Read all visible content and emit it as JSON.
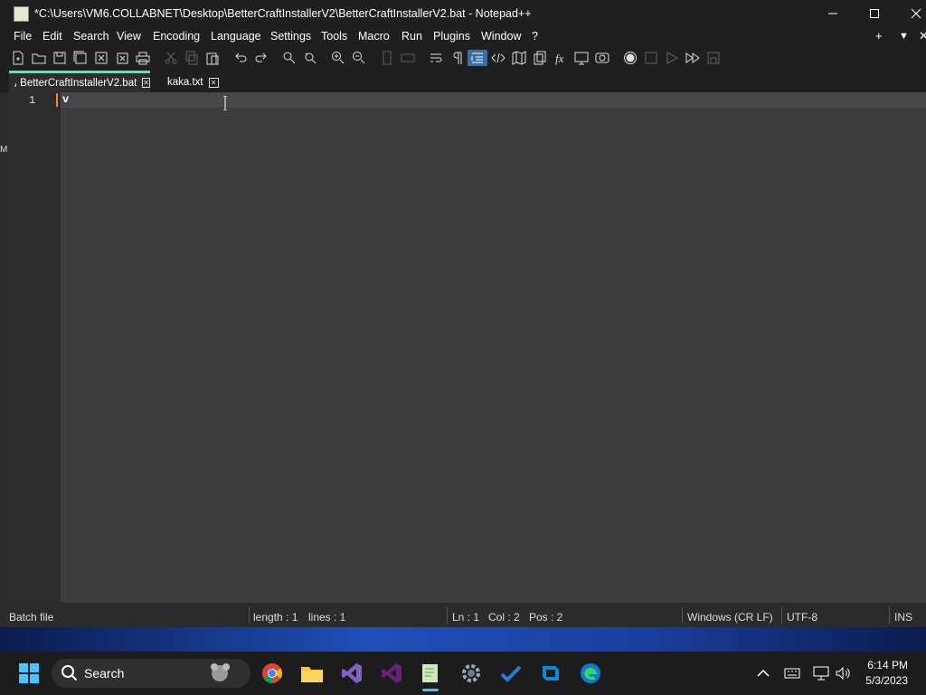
{
  "window": {
    "title": "*C:\\Users\\VM6.COLLABNET\\Desktop\\BetterCraftInstallerV2\\BetterCraftInstallerV2.bat - Notepad++",
    "controls": [
      "minimize",
      "maximize",
      "close"
    ]
  },
  "menu": {
    "items": [
      "File",
      "Edit",
      "Search",
      "View",
      "Encoding",
      "Language",
      "Settings",
      "Tools",
      "Macro",
      "Run",
      "Plugins",
      "Window",
      "?"
    ],
    "right": [
      "+",
      "▼",
      "✕"
    ]
  },
  "toolbar": {
    "icons": [
      "new-file-icon",
      "open-file-icon",
      "save-icon",
      "save-all-icon",
      "close-icon",
      "close-all-icon",
      "print-icon",
      "cut-icon",
      "copy-icon",
      "paste-icon",
      "undo-icon",
      "redo-icon",
      "find-icon",
      "replace-icon",
      "zoom-in-icon",
      "zoom-out-icon",
      "sync-vertical-icon",
      "sync-horizontal-icon",
      "word-wrap-icon",
      "show-all-characters-icon",
      "indent-guide-icon",
      "xml-tag-icon",
      "document-map-icon",
      "document-list-icon",
      "function-list-icon",
      "folder-workspace-icon",
      "monitoring-icon",
      "record-macro-icon",
      "stop-macro-icon",
      "play-macro-icon",
      "run-macro-multiple-icon",
      "save-macro-icon"
    ]
  },
  "tabs": [
    {
      "label": "BetterCraftInstallerV2.bat",
      "active": true,
      "modified": true
    },
    {
      "label": "kaka.txt",
      "active": false,
      "modified": false
    }
  ],
  "editor": {
    "lines": [
      {
        "number": "1",
        "text": "v"
      }
    ]
  },
  "status": {
    "language": "Batch file",
    "length": "length : 1",
    "lines": "lines : 1",
    "ln": "Ln : 1",
    "col": "Col : 2",
    "pos": "Pos : 2",
    "eol": "Windows (CR LF)",
    "encoding": "UTF-8",
    "mode": "INS"
  },
  "side_letter": "M",
  "taskbar": {
    "search_label": "Search",
    "apps": [
      "start-icon",
      "search-icon",
      "chrome-icon",
      "file-explorer-icon",
      "visual-studio-preview-icon",
      "visual-studio-icon",
      "notepad-plus-plus-icon",
      "settings-icon",
      "todo-icon",
      "azure-data-studio-icon",
      "edge-icon"
    ],
    "tray": [
      "chevron-up-icon",
      "keyboard-icon",
      "network-icon",
      "volume-icon"
    ],
    "time": "6:14 PM",
    "date": "5/3/2023"
  },
  "colors": {
    "tab_active_accent": "#7fd1b9",
    "toolbar_active": "#3a6ea5",
    "caret_marker": "#f28b25"
  }
}
